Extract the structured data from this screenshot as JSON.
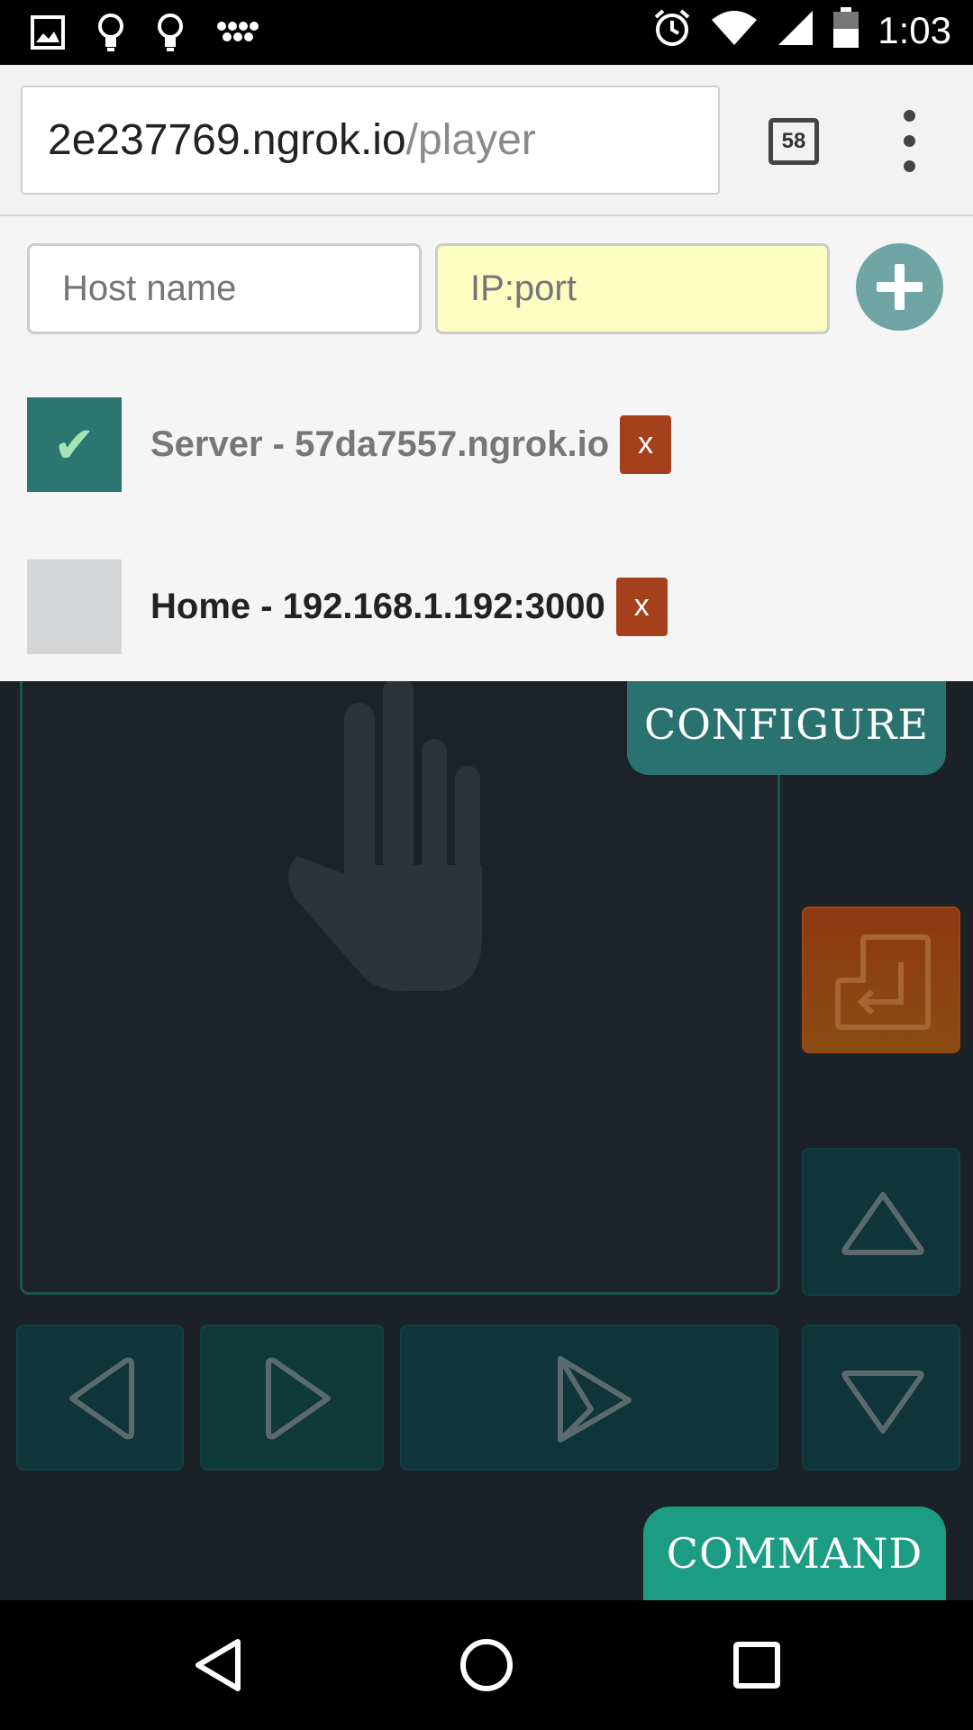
{
  "status_bar": {
    "time": "1:03",
    "left_icons": [
      "image-icon",
      "lightbulb-icon",
      "lightbulb-icon",
      "dots-icon"
    ],
    "right_icons": [
      "alarm-icon",
      "wifi-icon",
      "cell-signal-icon",
      "battery-icon"
    ]
  },
  "browser": {
    "url_host": "2e237769.ngrok.io",
    "url_path": "/player",
    "tab_count": "58"
  },
  "config": {
    "host_placeholder": "Host name",
    "ip_placeholder": "IP:port",
    "servers": [
      {
        "label": "Server - 57da7557.ngrok.io",
        "checked": true,
        "delete_label": "x"
      },
      {
        "label": "Home - 192.168.1.192:3000",
        "checked": false,
        "delete_label": "x"
      }
    ]
  },
  "controls": {
    "configure_label": "CONFIGURE",
    "command_label": "COMMAND"
  },
  "colors": {
    "accent_teal": "#2a726f",
    "command_green": "#1d9c84",
    "delete_red": "#a5401c",
    "ip_field_yellow": "#fbfdc1",
    "app_background": "#1b2126"
  }
}
